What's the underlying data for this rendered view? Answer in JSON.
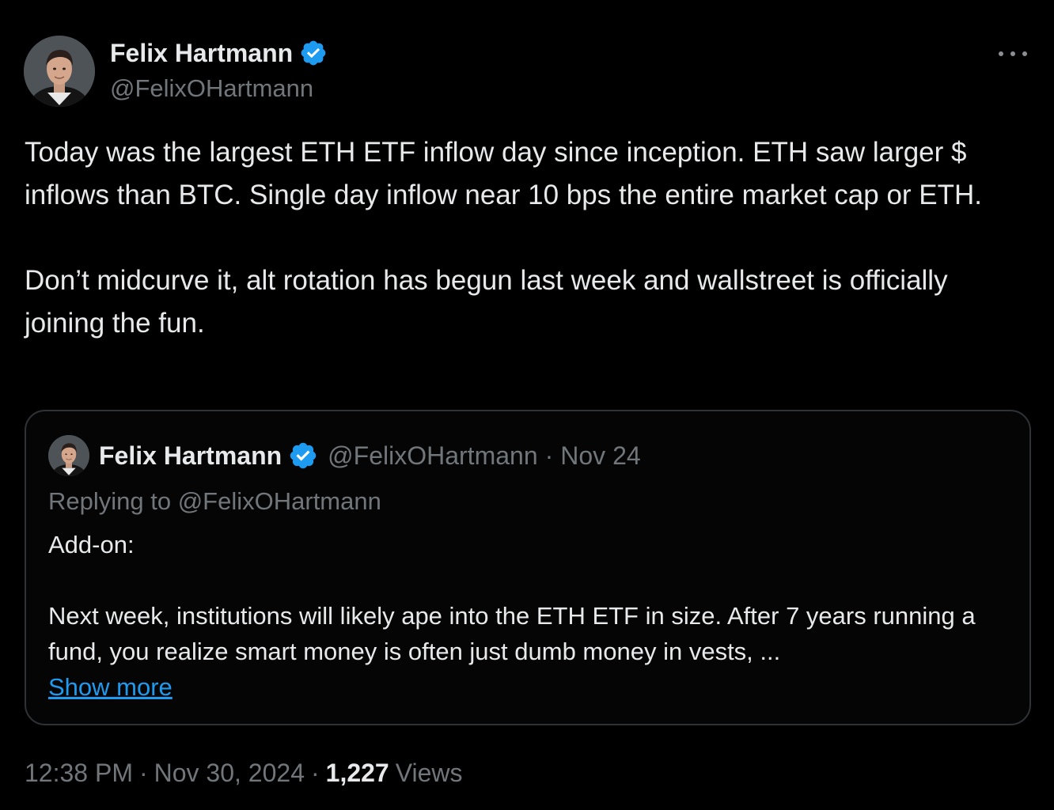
{
  "author": {
    "name": "Felix Hartmann",
    "handle": "@FelixOHartmann",
    "verified": true,
    "avatar_icon": "profile-photo"
  },
  "tweet": {
    "paragraphs": [
      "Today was the largest ETH ETF inflow day since inception. ETH saw larger $ inflows than BTC. Single day inflow near 10 bps the entire market cap or ETH.",
      "Don’t midcurve it, alt rotation has begun last week and wallstreet is officially joining the fun."
    ]
  },
  "quoted": {
    "name": "Felix Hartmann",
    "handle": "@FelixOHartmann",
    "separator": "·",
    "date": "Nov 24",
    "replying_to": "Replying to @FelixOHartmann",
    "paragraphs": [
      "Add-on:",
      "Next week, institutions will likely ape into the ETH ETF in size. After 7 years running a fund, you realize smart money is often just dumb money in vests, ..."
    ],
    "show_more_label": "Show more"
  },
  "meta": {
    "time": "12:38 PM",
    "separator": "·",
    "date": "Nov 30, 2024",
    "views_count": "1,227",
    "views_label": "Views"
  },
  "colors": {
    "background": "#000000",
    "text_primary": "#e7e9ea",
    "text_secondary": "#71767b",
    "verified_badge": "#1d9bf0",
    "link": "#1d9bf0",
    "quote_border": "#2f3336"
  },
  "icons": {
    "more": "more-horizontal-icon",
    "verified": "verified-badge-icon"
  }
}
